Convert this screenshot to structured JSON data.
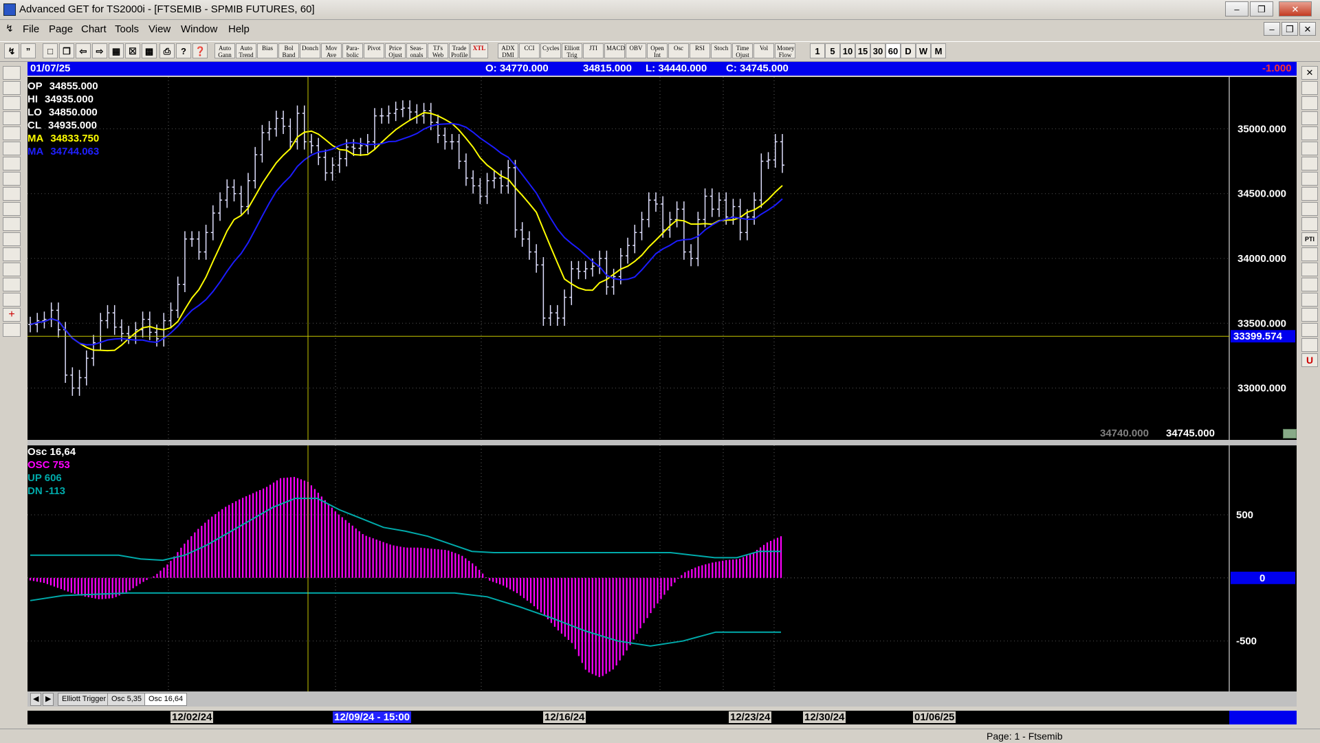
{
  "window": {
    "title": "Advanced GET for TS2000i - [FTSEMIB - SPMIB FUTURES, 60]"
  },
  "menu": [
    "File",
    "Page",
    "Chart",
    "Tools",
    "View",
    "Window",
    "Help"
  ],
  "toolbar": {
    "indicators": [
      "Auto Gann",
      "Auto Trend",
      "Bias",
      "Bol Band",
      "Donch",
      "Mov Ave",
      "Para-bolic",
      "Pivot",
      "Price Ojust",
      "Seas-onals",
      "TJ's Web",
      "Trade Profile",
      "XTL",
      "ADX DMI",
      "CCI",
      "Cycles",
      "Elliott Trig",
      "JTI",
      "MACD",
      "OBV",
      "Open Int",
      "Osc",
      "RSI",
      "Stoch",
      "Time Ojust",
      "Vol",
      "Money Flow"
    ],
    "intervals": [
      "1",
      "5",
      "10",
      "15",
      "30",
      "60",
      "D",
      "W",
      "M"
    ]
  },
  "info_bar": {
    "date": "01/07/25",
    "open": "O: 34770.000",
    "high": "34815.000",
    "low": "L: 34440.000",
    "close": "C: 34745.000",
    "change": "-1.000"
  },
  "price_panel": {
    "legend": [
      {
        "label": "OP",
        "value": "34855.000",
        "color": "#ffffff"
      },
      {
        "label": "HI",
        "value": "34935.000",
        "color": "#ffffff"
      },
      {
        "label": "LO",
        "value": "34850.000",
        "color": "#ffffff"
      },
      {
        "label": "CL",
        "value": "34935.000",
        "color": "#ffffff"
      },
      {
        "label": "MA",
        "value": "34833.750",
        "color": "#ffff00"
      },
      {
        "label": "MA",
        "value": "34744.063",
        "color": "#2020ff"
      }
    ],
    "y_ticks": [
      "35000.000",
      "34500.000",
      "34000.000",
      "33500.000",
      "33000.000"
    ],
    "cursor_price": "33399.574",
    "bottom_values": [
      "34740.000",
      "34745.000"
    ]
  },
  "osc_panel": {
    "legend": [
      {
        "label": "Osc 16,64",
        "color": "#ffffff"
      },
      {
        "label": "OSC 753",
        "color": "#ff00ff"
      },
      {
        "label": "UP   606",
        "color": "#00aaaa"
      },
      {
        "label": "DN   -113",
        "color": "#00aaaa"
      }
    ],
    "y_ticks": [
      "500",
      "0",
      "-500"
    ]
  },
  "tabs": [
    "Elliott Trigger",
    "Osc 5,35",
    "Osc 16,64"
  ],
  "dates": [
    "12/02/24",
    "12/09/24 - 15:00",
    "12/16/24",
    "12/23/24",
    "12/30/24",
    "01/06/25"
  ],
  "status": "Page: 1 - Ftsemib",
  "chart_data": {
    "type": "line",
    "title": "FTSEMIB - SPMIB FUTURES, 60",
    "ylim": [
      32600,
      35400
    ],
    "close": [
      33490,
      33520,
      33530,
      33600,
      33450,
      33100,
      33000,
      33080,
      33230,
      33350,
      33520,
      33580,
      33470,
      33420,
      33400,
      33450,
      33530,
      33430,
      33380,
      33520,
      33600,
      33800,
      34150,
      34150,
      34050,
      34200,
      34350,
      34450,
      34550,
      34500,
      34400,
      34600,
      34800,
      34970,
      35000,
      35080,
      35020,
      34900,
      35120,
      34900,
      34870,
      34780,
      34660,
      34720,
      34770,
      34860,
      34850,
      34870,
      34900,
      35100,
      35100,
      35120,
      35150,
      35160,
      35130,
      35100,
      35140,
      35050,
      34950,
      34900,
      34900,
      34750,
      34620,
      34560,
      34480,
      34600,
      34620,
      34560,
      34700,
      34220,
      34150,
      34050,
      33950,
      33540,
      33580,
      33540,
      33700,
      33920,
      33900,
      33920,
      33940,
      34000,
      33780,
      33860,
      34020,
      34100,
      34200,
      34300,
      34450,
      34420,
      34220,
      34300,
      34380,
      34050,
      34000,
      34300,
      34480,
      34380,
      34450,
      34320,
      34400,
      34200,
      34320,
      34450,
      34750,
      34760,
      34900,
      34720
    ],
    "osc": [
      -20,
      -40,
      -80,
      -120,
      -150,
      -170,
      -160,
      -110,
      -40,
      20,
      120,
      260,
      380,
      480,
      560,
      620,
      670,
      720,
      790,
      800,
      760,
      640,
      520,
      430,
      340,
      300,
      260,
      240,
      240,
      230,
      220,
      180,
      100,
      -20,
      -60,
      -120,
      -200,
      -300,
      -420,
      -520,
      -740,
      -790,
      -720,
      -560,
      -380,
      -220,
      -80,
      40,
      90,
      120,
      140,
      150,
      200,
      280,
      330
    ],
    "up": [
      180,
      180,
      180,
      180,
      180,
      150,
      140,
      180,
      260,
      360,
      460,
      560,
      630,
      630,
      540,
      470,
      400,
      370,
      330,
      270,
      210,
      200,
      200,
      200,
      200,
      200,
      200,
      200,
      200,
      200,
      180,
      160,
      160,
      210,
      210
    ],
    "dn": [
      -180,
      -140,
      -130,
      -120,
      -120,
      -120,
      -120,
      -120,
      -120,
      -120,
      -120,
      -120,
      -120,
      -120,
      -150,
      -230,
      -320,
      -420,
      -500,
      -540,
      -500,
      -430,
      -430,
      -430
    ]
  }
}
